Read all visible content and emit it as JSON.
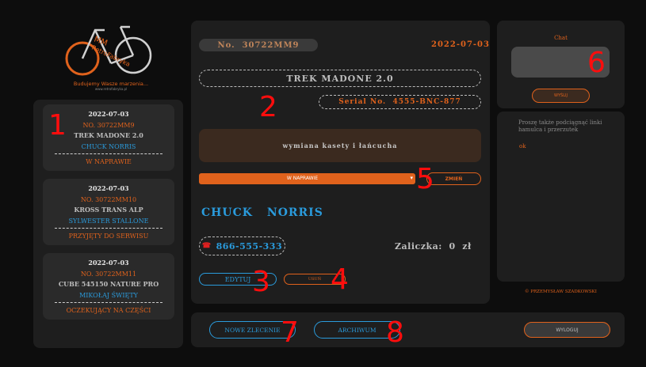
{
  "logo": {
    "text_mm": "MM",
    "text_retro": "RetroFabryka",
    "tagline": "Budujemy Wasze marzenia...",
    "url": "www.retrofabryka.pl"
  },
  "orders": [
    {
      "date": "2022-07-03",
      "number": "NO. 30722MM9",
      "bike": "TREK MADONE 2.0",
      "client": "CHUCK NORRIS",
      "status": "W NAPRAWIE"
    },
    {
      "date": "2022-07-03",
      "number": "NO. 30722MM10",
      "bike": "KROSS TRANS ALP",
      "client": "SYLWESTER STALLONE",
      "status": "PRZYJĘTY DO SERWISU"
    },
    {
      "date": "2022-07-03",
      "number": "NO. 30722MM11",
      "bike": "CUBE 545150 NATURE PRO",
      "client": "MIKOŁAJ ŚWIĘTY",
      "status": "OCZEKUJĄCY NA CZĘŚCI"
    }
  ],
  "detail": {
    "number_label": "No.",
    "number": "30722MM9",
    "date": "2022-07-03",
    "bike": "TREK MADONE 2.0",
    "serial_label": "Serial No.",
    "serial": "4555-BNC-877",
    "description": "wymiana kasety i łańcucha",
    "status_value": "W NAPRAWIE",
    "change_label": "ZMIEŃ",
    "client_first": "CHUCK",
    "client_last": "NORRIS",
    "phone": "866-555-333",
    "deposit_label": "Zaliczka:",
    "deposit_value": "0",
    "deposit_currency": "zł",
    "edit_label": "EDYTUJ",
    "delete_label": "USUŃ"
  },
  "chat": {
    "title": "Chat",
    "send_label": "WYŚLIJ",
    "note": "Proszę także podciągnąć linki hamulca i przerzutek",
    "reply": "ok"
  },
  "copyright": "© PRZEMYSŁAW SZADKOWSKI",
  "footer": {
    "new_order_label": "NOWE ZLECENIE",
    "archive_label": "ARCHIWUM",
    "logout_label": "WYLOGUJ"
  },
  "markers": [
    "1",
    "2",
    "3",
    "4",
    "5",
    "6",
    "7",
    "8"
  ],
  "colors": {
    "accent": "#e0621c",
    "link": "#2a9bdc",
    "marker": "#ff0d0d",
    "panel": "#1e1e1e"
  }
}
